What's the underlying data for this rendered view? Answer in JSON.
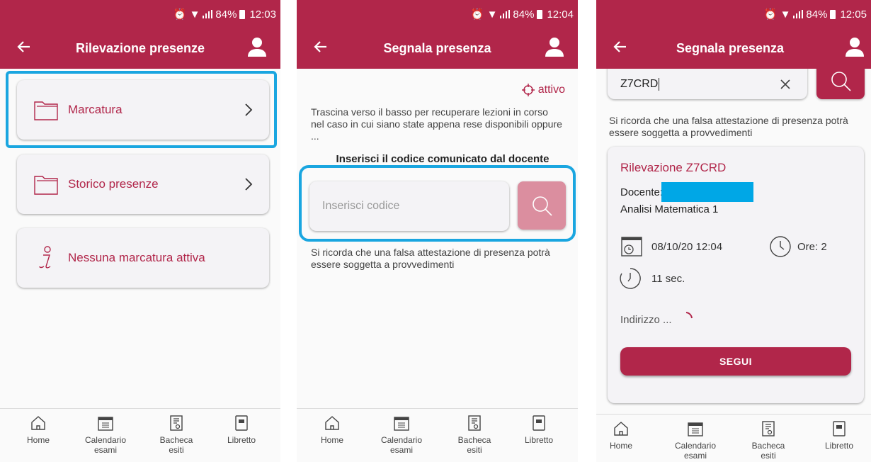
{
  "status": {
    "screen1": {
      "battery": "84%",
      "time": "12:03"
    },
    "screen2": {
      "battery": "84%",
      "time": "12:04"
    },
    "screen3": {
      "battery": "84%",
      "time": "12:05"
    }
  },
  "screen1": {
    "title": "Rilevazione presenze",
    "menu": [
      {
        "label": "Marcatura",
        "icon": "folder-icon"
      },
      {
        "label": "Storico presenze",
        "icon": "folder-icon"
      },
      {
        "label": "Nessuna marcatura attiva",
        "icon": "info-icon"
      }
    ]
  },
  "screen2": {
    "title": "Segnala presenza",
    "gps_status": "attivo",
    "intro": "Trascina verso il basso per recuperare lezioni in corso nel caso in cui siano state appena rese disponibili oppure ...",
    "code_heading": "Inserisci il codice comunicato dal docente",
    "code_placeholder": "Inserisci codice",
    "warning": "Si ricorda che una falsa attestazione di presenza potrà essere soggetta a provvedimenti"
  },
  "screen3": {
    "title": "Segnala presenza",
    "code_value": "Z7CRD",
    "warning": "Si ricorda che una falsa attestazione di presenza potrà essere soggetta a provvedimenti",
    "lesson": {
      "title": "Rilevazione Z7CRD",
      "teacher_label": "Docente:",
      "course": "Analisi Matematica 1",
      "datetime": "08/10/20 12:04",
      "hours": "Ore: 2",
      "elapsed": "11 sec.",
      "address": "Indirizzo ...",
      "follow_button": "SEGUI"
    }
  },
  "nav": {
    "items": [
      {
        "label1": "Home",
        "label2": ""
      },
      {
        "label1": "Calendario",
        "label2": "esami"
      },
      {
        "label1": "Bacheca",
        "label2": "esiti"
      },
      {
        "label1": "Libretto",
        "label2": ""
      }
    ]
  },
  "colors": {
    "brand": "#b1264a",
    "highlight": "#1aa6e0",
    "redacted": "#00a7e6"
  }
}
